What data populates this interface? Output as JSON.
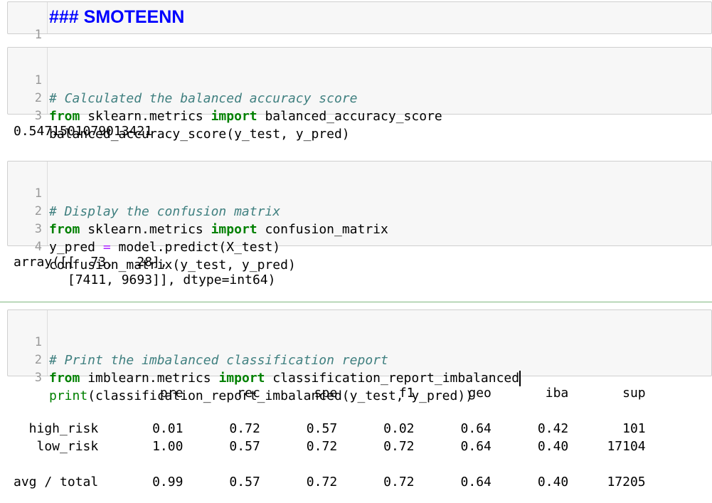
{
  "cells": {
    "heading": {
      "line_numbers": [
        "1"
      ],
      "text": "### SMOTEENN"
    },
    "balanced_accuracy": {
      "line_numbers": [
        "1",
        "2",
        "3"
      ],
      "comment": "# Calculated the balanced accuracy score",
      "line2": {
        "kw1": "from",
        "mod": " sklearn.metrics ",
        "kw2": "import",
        "rest": " balanced_accuracy_score"
      },
      "line3": "balanced_accuracy_score(y_test, y_pred)",
      "output": "0.5471501079013421"
    },
    "confusion": {
      "line_numbers": [
        "1",
        "2",
        "3",
        "4"
      ],
      "comment": "# Display the confusion matrix",
      "line2": {
        "kw1": "from",
        "mod": " sklearn.metrics ",
        "kw2": "import",
        "rest": " confusion_matrix"
      },
      "line3": {
        "lhs": "y_pred ",
        "op": "=",
        "rhs": " model.predict(X_test)"
      },
      "line4": "confusion_matrix(y_test, y_pred)",
      "output_line1": "array([[  73,   28],",
      "output_line2": "       [7411, 9693]], dtype=int64)"
    },
    "report": {
      "line_numbers": [
        "1",
        "2",
        "3"
      ],
      "comment": "# Print the imbalanced classification report",
      "line2": {
        "kw1": "from",
        "mod": " imblearn.metrics ",
        "kw2": "import",
        "rest": " classification_report_imbalanced"
      },
      "line3": {
        "fn": "print",
        "rest": "(classification_report_imbalanced(y_test, y_pred))"
      },
      "output_header": "                   pre       rec       spe        f1       geo       iba       sup",
      "output_row1": "  high_risk       0.01      0.72      0.57      0.02      0.64      0.42       101",
      "output_row2": "   low_risk       1.00      0.57      0.72      0.72      0.64      0.40     17104",
      "output_total": "avg / total       0.99      0.57      0.72      0.72      0.64      0.40     17205"
    }
  }
}
